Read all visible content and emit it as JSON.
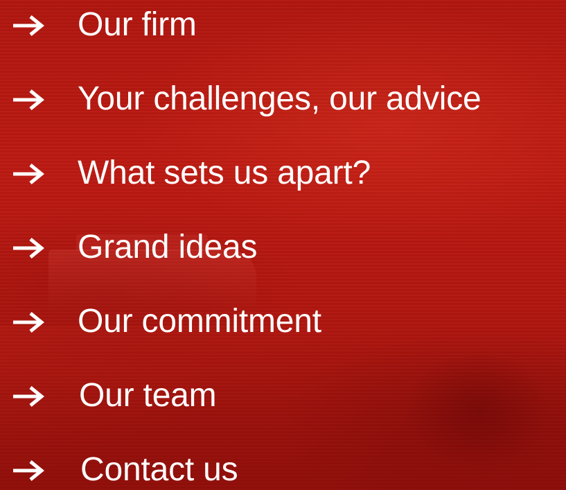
{
  "theme": {
    "background": "#b0170f",
    "text": "#ffffff",
    "accent": "#ffffff"
  },
  "nav": {
    "icon": "arrow-right-icon",
    "items": [
      {
        "label": "Our firm"
      },
      {
        "label": "Your challenges, our advice"
      },
      {
        "label": "What sets us apart?"
      },
      {
        "label": "Grand ideas"
      },
      {
        "label": "Our commitment"
      },
      {
        "label": "Our team"
      },
      {
        "label": "Contact us"
      }
    ]
  }
}
